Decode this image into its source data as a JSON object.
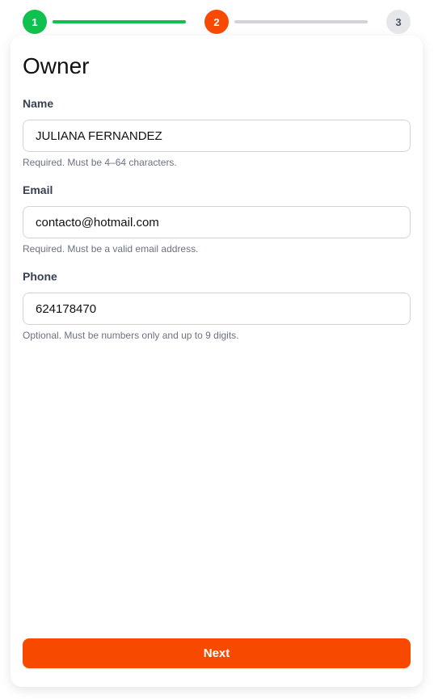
{
  "stepper": {
    "steps": [
      {
        "number": "1",
        "state": "complete",
        "color": "#10c14f"
      },
      {
        "number": "2",
        "state": "current",
        "color": "#f74a00"
      },
      {
        "number": "3",
        "state": "upcoming",
        "color": "#e5e7eb"
      }
    ]
  },
  "form": {
    "title": "Owner",
    "fields": [
      {
        "label": "Name",
        "value": "JULIANA FERNANDEZ",
        "help": "Required. Must be 4–64 characters."
      },
      {
        "label": "Email",
        "value": "contacto@hotmail.com",
        "help": "Required. Must be a valid email address."
      },
      {
        "label": "Phone",
        "value": "624178470",
        "help": "Optional. Must be numbers only and up to 9 digits."
      }
    ],
    "next_label": "Next"
  }
}
